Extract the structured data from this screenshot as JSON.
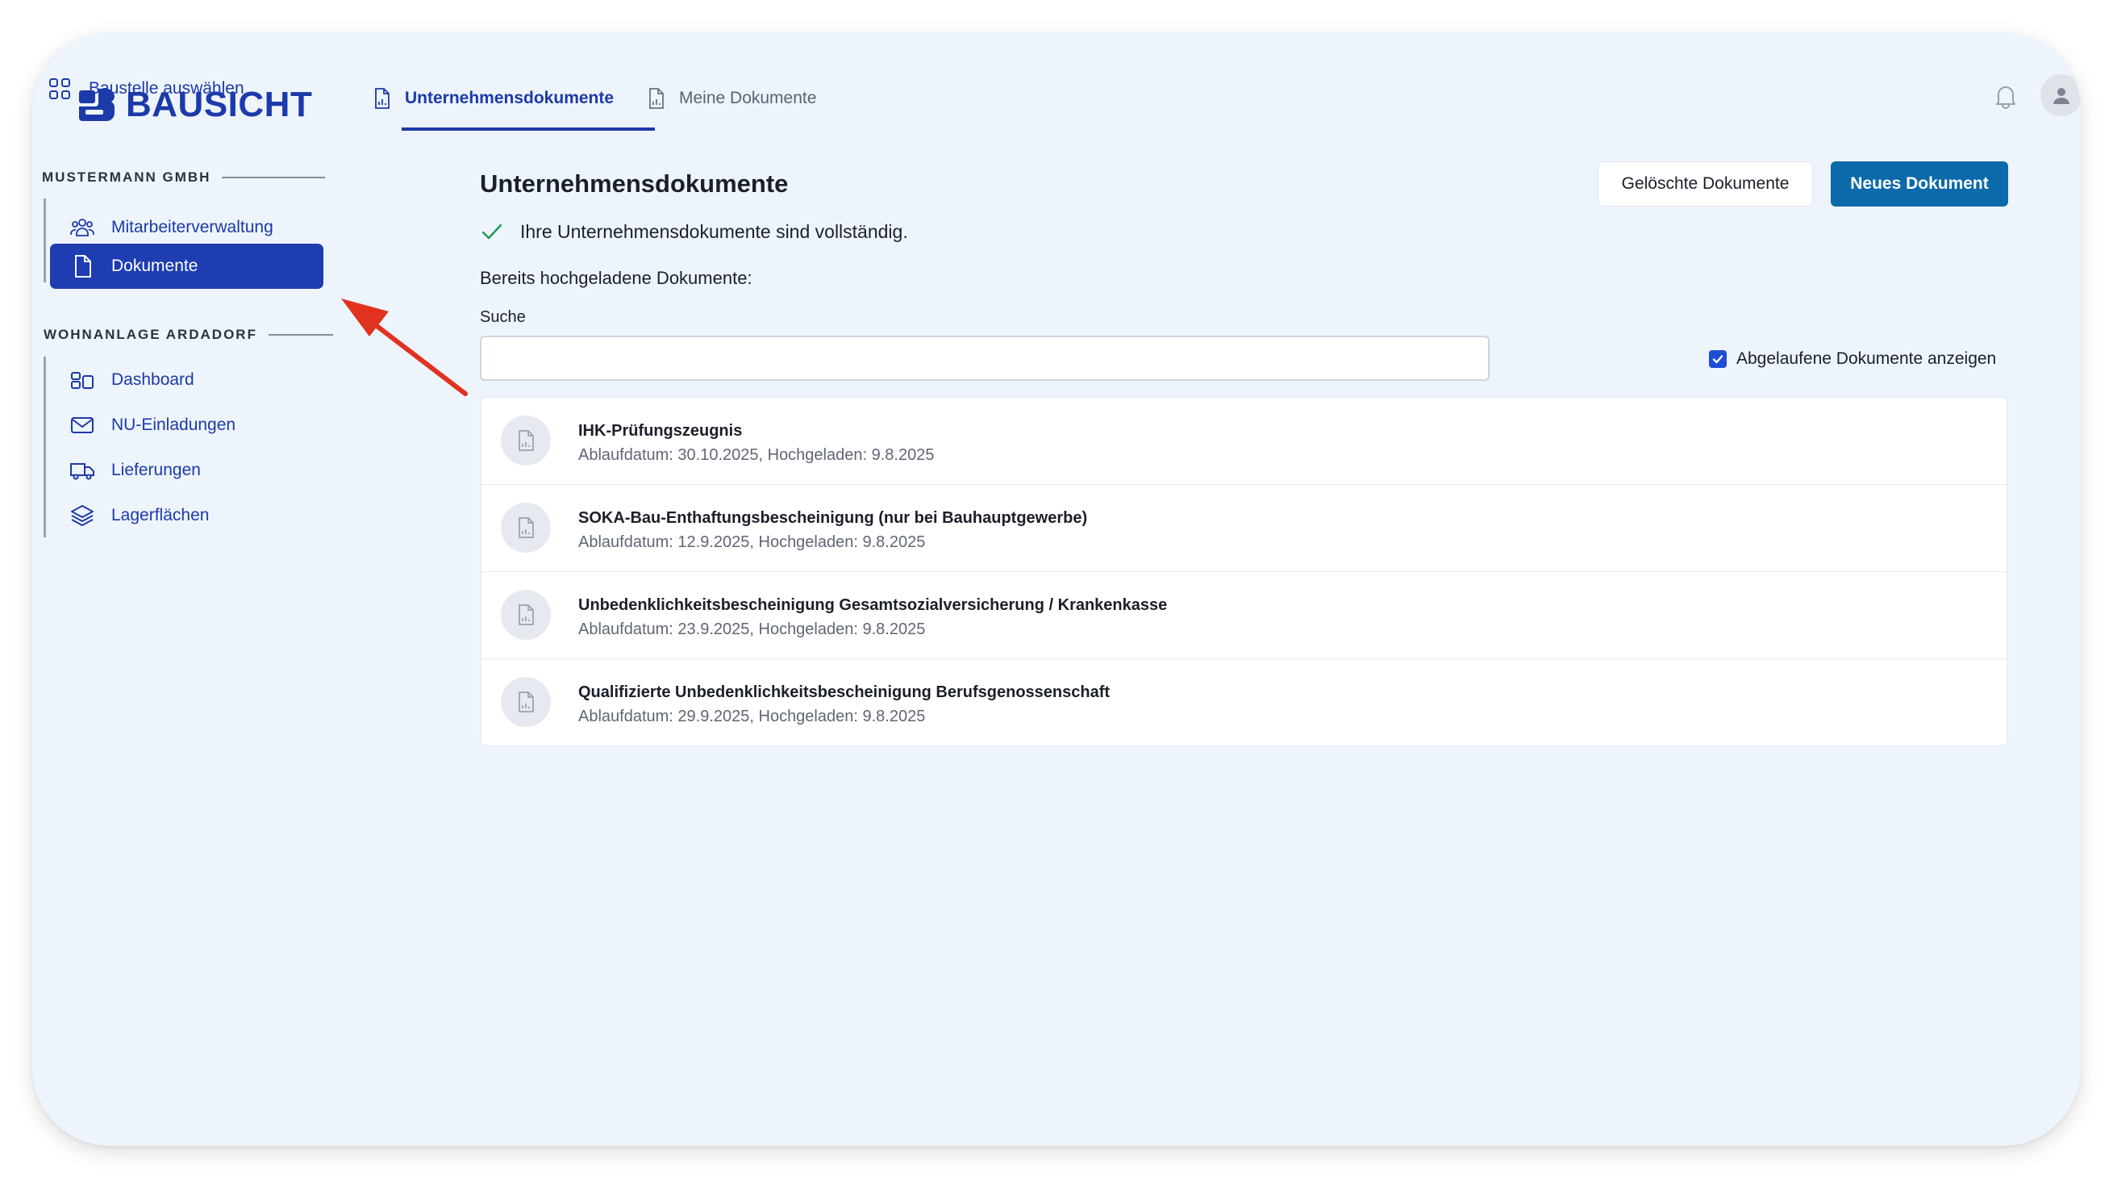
{
  "app": {
    "name": "BAUSICHT",
    "brand_color": "#1c3aa9",
    "primary_button_color": "#0c6aab"
  },
  "sidebar": {
    "select_site": {
      "label": "Baustelle auswählen",
      "icon": "grid-icon"
    },
    "sections": [
      {
        "title": "MUSTERMANN GMBH",
        "items": [
          {
            "label": "Mitarbeiterverwaltung",
            "icon": "users-icon",
            "active": false
          },
          {
            "label": "Dokumente",
            "icon": "document-icon",
            "active": true
          }
        ]
      },
      {
        "title": "WOHNANLAGE ARDADORF",
        "items": [
          {
            "label": "Dashboard",
            "icon": "dashboard-icon",
            "active": false
          },
          {
            "label": "NU-Einladungen",
            "icon": "mail-icon",
            "active": false
          },
          {
            "label": "Lieferungen",
            "icon": "truck-icon",
            "active": false
          },
          {
            "label": "Lagerflächen",
            "icon": "layers-icon",
            "active": false
          }
        ]
      }
    ]
  },
  "tabs": [
    {
      "label": "Unternehmensdokumente",
      "icon": "document-chart-icon",
      "active": true
    },
    {
      "label": "Meine Dokumente",
      "icon": "document-chart-icon",
      "active": false
    }
  ],
  "header": {
    "notifications_icon": "bell-icon",
    "avatar_icon": "user-icon"
  },
  "main": {
    "title": "Unternehmensdokumente",
    "deleted_button": "Gelöschte Dokumente",
    "new_button": "Neues Dokument",
    "status": "Ihre Unternehmensdokumente sind vollständig.",
    "status_color": "#1a9b4b",
    "uploaded_heading": "Bereits hochgeladene Dokumente:",
    "search": {
      "label": "Suche",
      "value": "",
      "placeholder": ""
    },
    "show_expired": {
      "label": "Abgelaufene Dokumente anzeigen",
      "checked": true
    },
    "documents": [
      {
        "name": "IHK-Prüfungszeugnis",
        "meta": "Ablaufdatum: 30.10.2025, Hochgeladen: 9.8.2025"
      },
      {
        "name": "SOKA-Bau-Enthaftungsbescheinigung (nur bei Bauhauptgewerbe)",
        "meta": "Ablaufdatum: 12.9.2025, Hochgeladen: 9.8.2025"
      },
      {
        "name": "Unbedenklichkeitsbescheinigung Gesamtsozialversicherung / Krankenkasse",
        "meta": "Ablaufdatum: 23.9.2025, Hochgeladen: 9.8.2025"
      },
      {
        "name": "Qualifizierte Unbedenklichkeitsbescheinigung Berufsgenossenschaft",
        "meta": "Ablaufdatum: 29.9.2025, Hochgeladen: 9.8.2025"
      }
    ]
  },
  "annotation": {
    "icon": "arrow-icon",
    "color": "#e0321f"
  }
}
